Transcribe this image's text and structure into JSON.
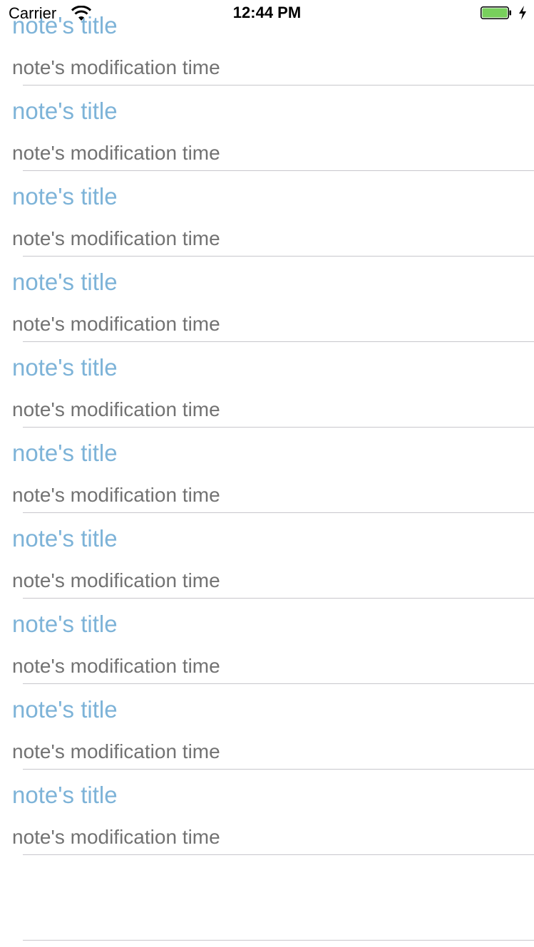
{
  "status_bar": {
    "carrier": "Carrier",
    "time": "12:44 PM",
    "battery_color": "#78d05c"
  },
  "colors": {
    "title": "#7db3d8",
    "subtitle": "#727272",
    "separator": "#c8c7cc"
  },
  "notes": [
    {
      "title": "note's title",
      "time": "note's modification time"
    },
    {
      "title": "note's title",
      "time": "note's modification time"
    },
    {
      "title": "note's title",
      "time": "note's modification time"
    },
    {
      "title": "note's title",
      "time": "note's modification time"
    },
    {
      "title": "note's title",
      "time": "note's modification time"
    },
    {
      "title": "note's title",
      "time": "note's modification time"
    },
    {
      "title": "note's title",
      "time": "note's modification time"
    },
    {
      "title": "note's title",
      "time": "note's modification time"
    },
    {
      "title": "note's title",
      "time": "note's modification time"
    },
    {
      "title": "note's title",
      "time": "note's modification time"
    }
  ]
}
